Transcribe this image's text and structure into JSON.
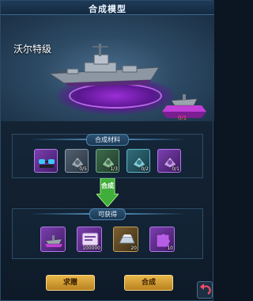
{
  "header": {
    "title": "合成模型"
  },
  "showcase": {
    "ship_name": "沃尔特级",
    "counter": "0/1"
  },
  "materials": {
    "title": "合成材料",
    "items": [
      {
        "icon": "glasses-icon",
        "qty": "",
        "rarity": "purple"
      },
      {
        "icon": "part-icon",
        "qty": "0/5",
        "rarity": "gray"
      },
      {
        "icon": "part-icon",
        "qty": "1/3",
        "rarity": "green"
      },
      {
        "icon": "part-icon",
        "qty": "0/2",
        "rarity": "teal"
      },
      {
        "icon": "part-icon",
        "qty": "0/1",
        "rarity": "purple"
      }
    ]
  },
  "merge": {
    "label": "合成"
  },
  "rewards": {
    "title": "可获得",
    "items": [
      {
        "icon": "ship-model-icon",
        "qty": "",
        "rarity": "purple"
      },
      {
        "icon": "ticket-icon",
        "qty": "100000",
        "rarity": "purple"
      },
      {
        "icon": "ingot-icon",
        "qty": "20",
        "rarity": "gold"
      },
      {
        "icon": "puzzle-icon",
        "qty": "10",
        "rarity": "purple"
      }
    ]
  },
  "buttons": {
    "request": "求赠",
    "combine": "合成"
  },
  "colors": {
    "accent_gold": "#e8b64a",
    "counter_red": "#ff5a5a",
    "purple_glow": "#9b2ed6"
  }
}
